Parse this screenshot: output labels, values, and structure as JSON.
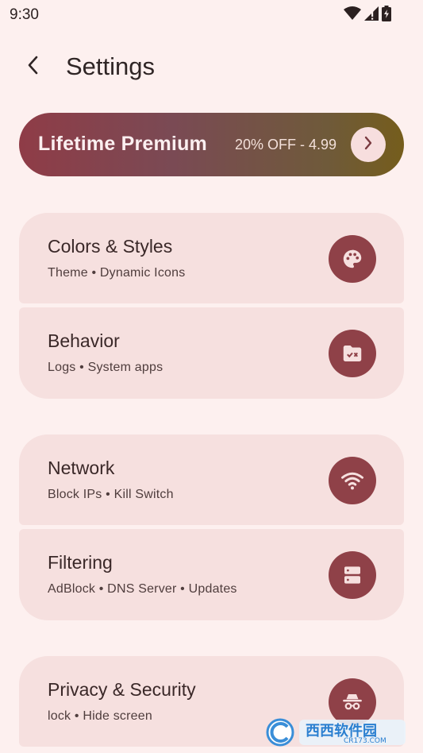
{
  "status_bar": {
    "time": "9:30",
    "icons": [
      "wifi-icon",
      "cellular-no-signal-icon",
      "battery-charging-icon"
    ]
  },
  "top_bar": {
    "back_icon": "chevron-left-icon",
    "title": "Settings"
  },
  "premium": {
    "title": "Lifetime Premium",
    "offer": "20% OFF - 4.99",
    "arrow_icon": "chevron-right-icon"
  },
  "groups": [
    {
      "items": [
        {
          "title": "Colors & Styles",
          "subtitle": "Theme • Dynamic Icons",
          "icon": "palette-icon"
        },
        {
          "title": "Behavior",
          "subtitle": "Logs • System apps",
          "icon": "folder-check-icon"
        }
      ]
    },
    {
      "items": [
        {
          "title": "Network",
          "subtitle": "Block IPs • Kill Switch",
          "icon": "wifi-icon"
        },
        {
          "title": "Filtering",
          "subtitle": "AdBlock • DNS Server • Updates",
          "icon": "dns-server-icon"
        }
      ]
    },
    {
      "items": [
        {
          "title": "Privacy & Security",
          "subtitle": "lock • Hide screen",
          "icon": "incognito-icon"
        }
      ]
    }
  ],
  "colors": {
    "background": "#fdf0ef",
    "card": "#f6e0df",
    "icon_circle": "#8f4148",
    "premium_gradient_start": "#8f3c47",
    "premium_gradient_end": "#755d1c"
  },
  "watermark": {
    "text": "西西软件园",
    "subtext": "CR173.COM"
  }
}
